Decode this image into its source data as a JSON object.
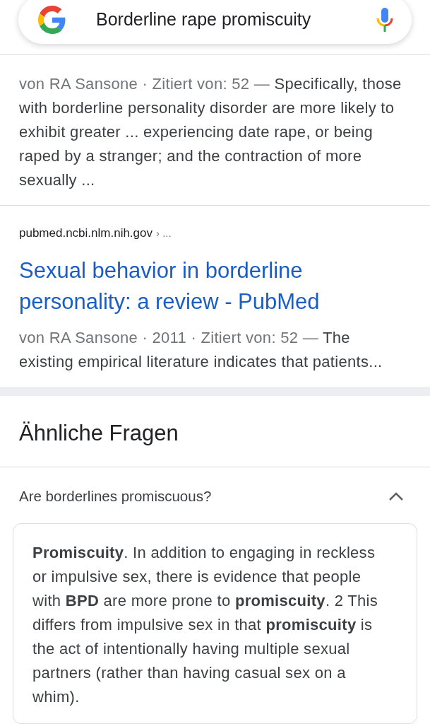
{
  "search": {
    "query": "Borderline rape promiscuity"
  },
  "results": [
    {
      "meta": "von RA Sansone · Zitiert von: 52 —",
      "snippet": "Specifically, those with borderline personality disorder are more likely to exhibit greater ... experiencing date rape, or being raped by a stranger; and the contraction of more sexually  ..."
    },
    {
      "url": "pubmed.ncbi.nlm.nih.gov",
      "breadcrumb": "› ...",
      "title": "Sexual behavior in borderline personality: a review - PubMed",
      "meta": "von RA Sansone · 2011 · Zitiert von: 52 —",
      "snippet": "The existing empirical literature indicates that patients..."
    }
  ],
  "related_questions": {
    "heading": "Ähnliche Fragen",
    "items": [
      {
        "question": "Are borderlines promiscuous?",
        "expanded": true,
        "answer": "**Promiscuity**. In addition to engaging in reckless or impulsive sex, there is evidence that people with **BPD** are more prone to **promiscuity**. 2 This differs from impulsive sex in that **promiscuity** is the act of intentionally having multiple sexual partners (rather than having casual sex on a whim)."
      }
    ]
  }
}
